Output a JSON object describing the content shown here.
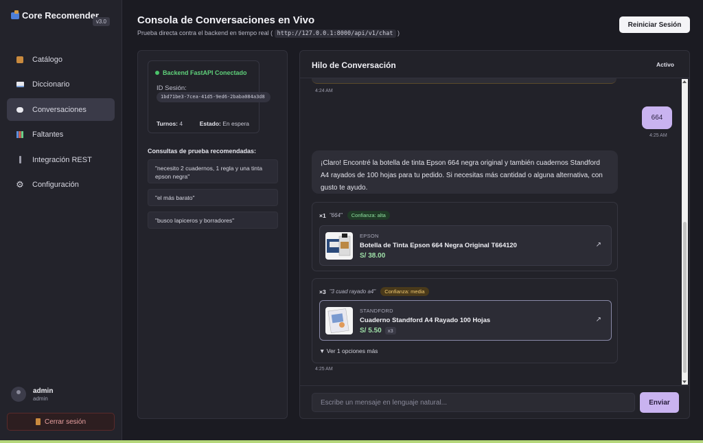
{
  "sidebar": {
    "brand": "Core Recomender",
    "version": "v3.0",
    "items": [
      {
        "label": "Catálogo",
        "icon": "box-icon"
      },
      {
        "label": "Diccionario",
        "icon": "book-icon"
      },
      {
        "label": "Conversaciones",
        "icon": "chat-bubble-icon",
        "active": true
      },
      {
        "label": "Faltantes",
        "icon": "bar-chart-icon"
      },
      {
        "label": "Integración REST",
        "icon": "plug-icon"
      },
      {
        "label": "Configuración",
        "icon": "gear-icon"
      }
    ],
    "user": {
      "name": "admin",
      "role": "admin"
    },
    "logout_label": "Cerrar sesión"
  },
  "header": {
    "title": "Consola de Conversaciones en Vivo",
    "subtitle_prefix": "Prueba directa contra el backend en tiempo real (",
    "endpoint": "http://127.0.0.1:8000/api/v1/chat",
    "subtitle_suffix": ")",
    "reset_label": "Reiniciar Sesión"
  },
  "session": {
    "status": "Backend FastAPI Conectado",
    "id_label": "ID Sesión:",
    "id": "1bd71be3-7cea-41d5-9ed6-2baba084a3d8",
    "turns_label": "Turnos:",
    "turns": "4",
    "state_label": "Estado:",
    "state": "En espera"
  },
  "queries": {
    "title": "Consultas de prueba recomendadas:",
    "items": [
      "\"necesito 2 cuadernos, 1 regla y una tinta epson negra\"",
      "\"el más barato\"",
      "\"busco lapiceros y borradores\""
    ]
  },
  "conversation": {
    "title": "Hilo de Conversación",
    "status": "Activo",
    "messages": [
      {
        "time": "4:24 AM"
      },
      {
        "role": "user",
        "text": "664",
        "time": "4:25 AM"
      },
      {
        "role": "bot",
        "text": "¡Claro! Encontré la botella de tinta Epson 664 negra original y también cuadernos Standford A4 rayados de 100 hojas para tu pedido. Si necesitas más cantidad o alguna alternativa, con gusto te ayudo.",
        "time": "4:25 AM"
      }
    ],
    "matches": [
      {
        "qty": "×1",
        "term": "\"664\"",
        "confidence": "Confianza: alta",
        "product": {
          "brand": "EPSON",
          "name": "Botella de Tinta Epson 664 Negra Original T664120",
          "price": "S/ 38.00"
        }
      },
      {
        "qty": "×3",
        "term": "\"3 cuad rayado a4\"",
        "confidence": "Confianza: media",
        "product": {
          "brand": "STANDFORD",
          "name": "Cuaderno Standford A4 Rayado 100 Hojas",
          "price": "S/ 5.50",
          "qty_badge": "x3"
        },
        "more": "▼ Ver 1 opciones más"
      }
    ],
    "input_placeholder": "Escribe un mensaje en lenguaje natural...",
    "send_label": "Enviar"
  },
  "colors": {
    "accent": "#c9b3f0",
    "success": "#4bc46a",
    "price": "#9fe0a8"
  }
}
